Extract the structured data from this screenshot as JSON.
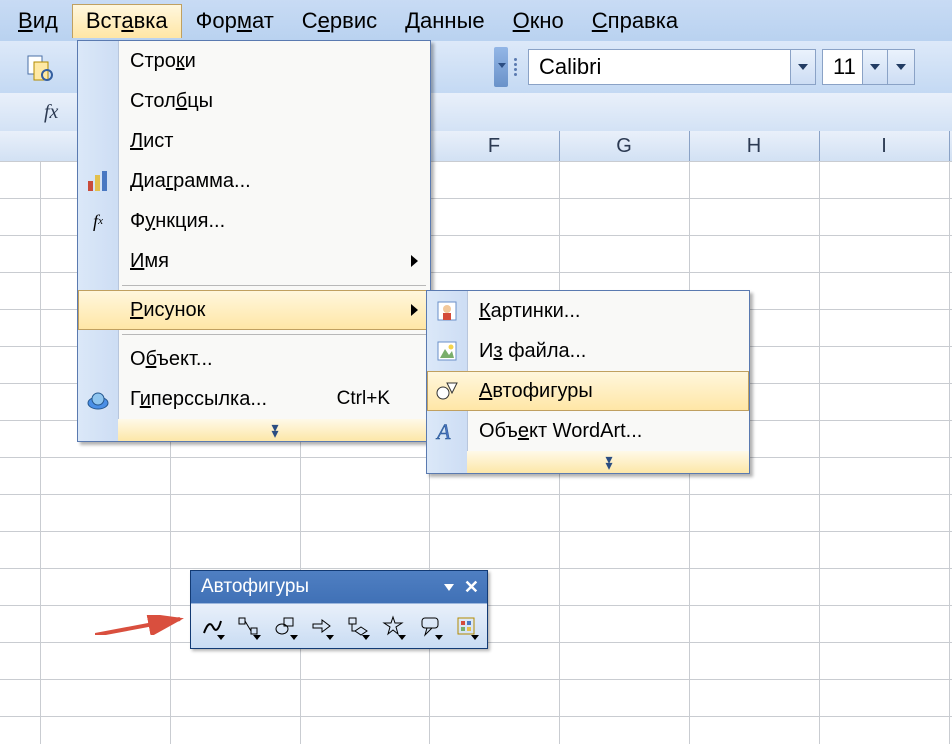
{
  "menubar": {
    "items": [
      {
        "pre": "",
        "u": "В",
        "post": "ид"
      },
      {
        "pre": "Вст",
        "u": "а",
        "post": "вка"
      },
      {
        "pre": "Фор",
        "u": "м",
        "post": "ат"
      },
      {
        "pre": "С",
        "u": "е",
        "post": "рвис"
      },
      {
        "pre": "",
        "u": "Д",
        "post": "анные"
      },
      {
        "pre": "",
        "u": "О",
        "post": "кно"
      },
      {
        "pre": "",
        "u": "С",
        "post": "правка"
      }
    ]
  },
  "toolbar": {
    "font_name": "Calibri",
    "font_size": "11"
  },
  "formula_bar": {
    "fx_label": "fx"
  },
  "columns": {
    "f": "F",
    "g": "G",
    "h": "H",
    "i": "I"
  },
  "insert_menu": {
    "rows": {
      "pre": "Стро",
      "u": "к",
      "post": "и"
    },
    "columns_": {
      "pre": "Стол",
      "u": "б",
      "post": "цы"
    },
    "sheet": {
      "pre": "",
      "u": "Л",
      "post": "ист"
    },
    "chart": {
      "pre": "Диа",
      "u": "г",
      "post": "рамма..."
    },
    "function": {
      "pre": "Ф",
      "u": "у",
      "post": "нкция..."
    },
    "name": {
      "pre": "",
      "u": "И",
      "post": "мя"
    },
    "picture": {
      "pre": "",
      "u": "Р",
      "post": "исунок"
    },
    "object": {
      "pre": "О",
      "u": "б",
      "post": "ъект..."
    },
    "hyperlink": {
      "pre": "Г",
      "u": "и",
      "post": "перссылка..."
    },
    "hyperlink_shortcut": "Ctrl+K"
  },
  "picture_submenu": {
    "clipart": {
      "pre": "",
      "u": "К",
      "post": "артинки..."
    },
    "from_file": {
      "pre": "И",
      "u": "з",
      "post": " файла..."
    },
    "autoshapes": {
      "pre": "",
      "u": "А",
      "post": "втофигуры"
    },
    "wordart": {
      "pre": "Объ",
      "u": "е",
      "post": "кт WordArt..."
    }
  },
  "autoshapes_toolbar": {
    "title": "Автофигуры",
    "buttons": [
      "lines-icon",
      "connectors-icon",
      "basic-shapes-icon",
      "block-arrows-icon",
      "flowchart-icon",
      "stars-icon",
      "callouts-icon",
      "more-autoshapes-icon"
    ]
  }
}
